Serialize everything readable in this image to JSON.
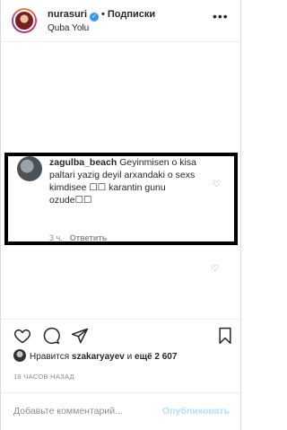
{
  "header": {
    "username": "nurasuri",
    "separator": "•",
    "follow_label": "Подписки",
    "location": "Quba Yolu",
    "more_icon": "more-horizontal-icon"
  },
  "comment": {
    "username": "zagulba_beach",
    "text": " Geyinmisen o kisa paltari yazig deyil arxandaki o sexs kimdisee ☐☐ karantin gunu ozude☐☐",
    "time": "3 ч.",
    "reply_label": "Ответить"
  },
  "actions": {
    "like_icon": "heart-icon",
    "comment_icon": "comment-icon",
    "share_icon": "send-icon",
    "save_icon": "bookmark-icon"
  },
  "likes": {
    "prefix": "Нравится ",
    "user": "szakaryayev",
    "middle": " и ",
    "others": "ещё 2 607"
  },
  "timestamp": "18 ЧАСОВ НАЗАД",
  "comment_input": {
    "placeholder": "Добавьте комментарий...",
    "publish_label": "Опубликовать"
  },
  "colors": {
    "verified": "#3897f0",
    "publish_disabled": "#b2dffc",
    "muted": "#8e8e8e"
  }
}
